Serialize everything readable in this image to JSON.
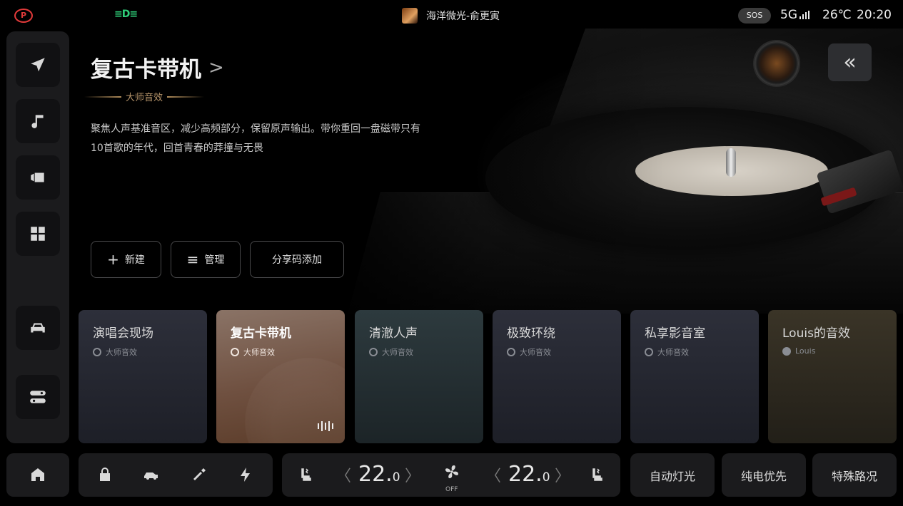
{
  "statusbar": {
    "park_label": "P",
    "light_label": "≡D≡",
    "track": "海洋微光-俞更寅",
    "sos": "SOS",
    "network": "5G",
    "temperature": "26℃",
    "time": "20:20"
  },
  "hero": {
    "title": "复古卡带机",
    "chevron": ">",
    "badge": "大师音效",
    "description": "聚焦人声基准音区，减少高频部分，保留原声输出。带你重回一盘磁带只有10首歌的年代，回首青春的莽撞与无畏",
    "collapse_icon": "«"
  },
  "actions": [
    {
      "label": "新建",
      "icon": "+"
    },
    {
      "label": "管理",
      "icon": "≡"
    },
    {
      "label": "分享码添加"
    }
  ],
  "cards": [
    {
      "title": "演唱会现场",
      "sub": "大师音效"
    },
    {
      "title": "复古卡带机",
      "sub": "大师音效",
      "active": true
    },
    {
      "title": "清澈人声",
      "sub": "大师音效"
    },
    {
      "title": "极致环绕",
      "sub": "大师音效"
    },
    {
      "title": "私享影音室",
      "sub": "大师音效"
    },
    {
      "title": "Louis的音效",
      "sub": "Louis"
    }
  ],
  "climate": {
    "left_temp": "22.",
    "left_decimal": "0",
    "right_temp": "22.",
    "right_decimal": "0",
    "fan_state": "OFF",
    "chev_left": "〈",
    "chev_right": "〉"
  },
  "quick": {
    "auto_light": "自动灯光",
    "ev_priority": "纯电优先",
    "special_road": "特殊路况"
  },
  "icons": {
    "rail": [
      "navigation-icon",
      "music-icon",
      "video-icon",
      "apps-icon",
      "car-icon",
      "toggle-settings-icon"
    ],
    "dock": [
      "home-icon",
      "lock-icon",
      "car-side-icon",
      "fuel-icon",
      "bolt-icon"
    ]
  },
  "colors": {
    "accent_gold": "#b6946a",
    "active_card": "#6f5040",
    "park_red": "#e23a3a",
    "light_green": "#2fd07a"
  }
}
